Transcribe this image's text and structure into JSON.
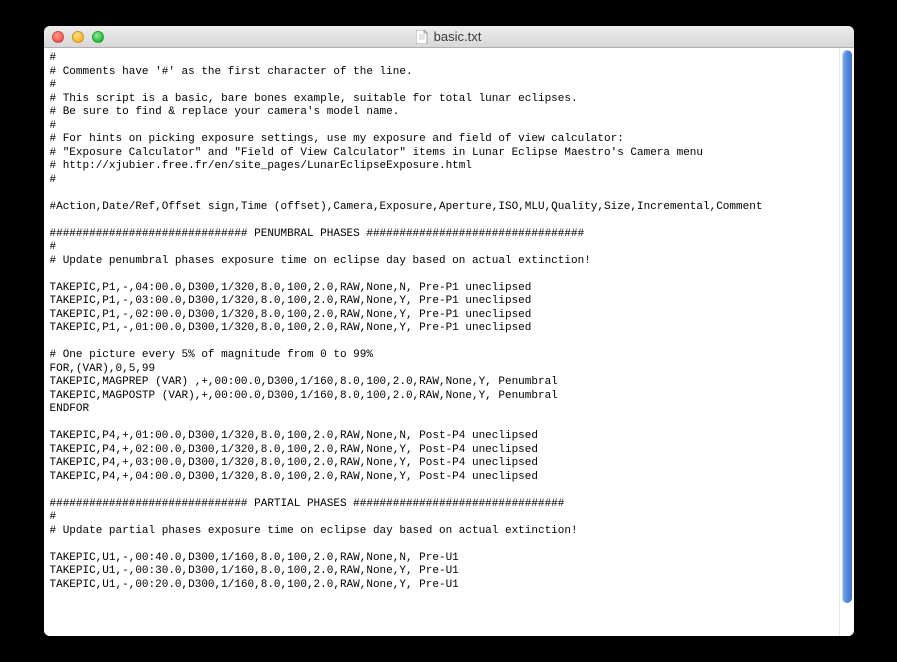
{
  "window": {
    "title": "basic.txt"
  },
  "file": {
    "lines": [
      "#",
      "# Comments have '#' as the first character of the line.",
      "#",
      "# This script is a basic, bare bones example, suitable for total lunar eclipses.",
      "# Be sure to find & replace your camera's model name.",
      "#",
      "# For hints on picking exposure settings, use my exposure and field of view calculator:",
      "# \"Exposure Calculator\" and \"Field of View Calculator\" items in Lunar Eclipse Maestro's Camera menu",
      "# http://xjubier.free.fr/en/site_pages/LunarEclipseExposure.html",
      "#",
      "",
      "#Action,Date/Ref,Offset sign,Time (offset),Camera,Exposure,Aperture,ISO,MLU,Quality,Size,Incremental,Comment",
      "",
      "############################## PENUMBRAL PHASES #################################",
      "#",
      "# Update penumbral phases exposure time on eclipse day based on actual extinction!",
      "",
      "TAKEPIC,P1,-,04:00.0,D300,1/320,8.0,100,2.0,RAW,None,N, Pre-P1 uneclipsed",
      "TAKEPIC,P1,-,03:00.0,D300,1/320,8.0,100,2.0,RAW,None,Y, Pre-P1 uneclipsed",
      "TAKEPIC,P1,-,02:00.0,D300,1/320,8.0,100,2.0,RAW,None,Y, Pre-P1 uneclipsed",
      "TAKEPIC,P1,-,01:00.0,D300,1/320,8.0,100,2.0,RAW,None,Y, Pre-P1 uneclipsed",
      "",
      "# One picture every 5% of magnitude from 0 to 99%",
      "FOR,(VAR),0,5,99",
      "TAKEPIC,MAGPREP (VAR) ,+,00:00.0,D300,1/160,8.0,100,2.0,RAW,None,Y, Penumbral",
      "TAKEPIC,MAGPOSTP (VAR),+,00:00.0,D300,1/160,8.0,100,2.0,RAW,None,Y, Penumbral",
      "ENDFOR",
      "",
      "TAKEPIC,P4,+,01:00.0,D300,1/320,8.0,100,2.0,RAW,None,N, Post-P4 uneclipsed",
      "TAKEPIC,P4,+,02:00.0,D300,1/320,8.0,100,2.0,RAW,None,Y, Post-P4 uneclipsed",
      "TAKEPIC,P4,+,03:00.0,D300,1/320,8.0,100,2.0,RAW,None,Y, Post-P4 uneclipsed",
      "TAKEPIC,P4,+,04:00.0,D300,1/320,8.0,100,2.0,RAW,None,Y, Post-P4 uneclipsed",
      "",
      "############################## PARTIAL PHASES ################################",
      "#",
      "# Update partial phases exposure time on eclipse day based on actual extinction!",
      "",
      "TAKEPIC,U1,-,00:40.0,D300,1/160,8.0,100,2.0,RAW,None,N, Pre-U1",
      "TAKEPIC,U1,-,00:30.0,D300,1/160,8.0,100,2.0,RAW,None,Y, Pre-U1",
      "TAKEPIC,U1,-,00:20.0,D300,1/160,8.0,100,2.0,RAW,None,Y, Pre-U1"
    ]
  }
}
